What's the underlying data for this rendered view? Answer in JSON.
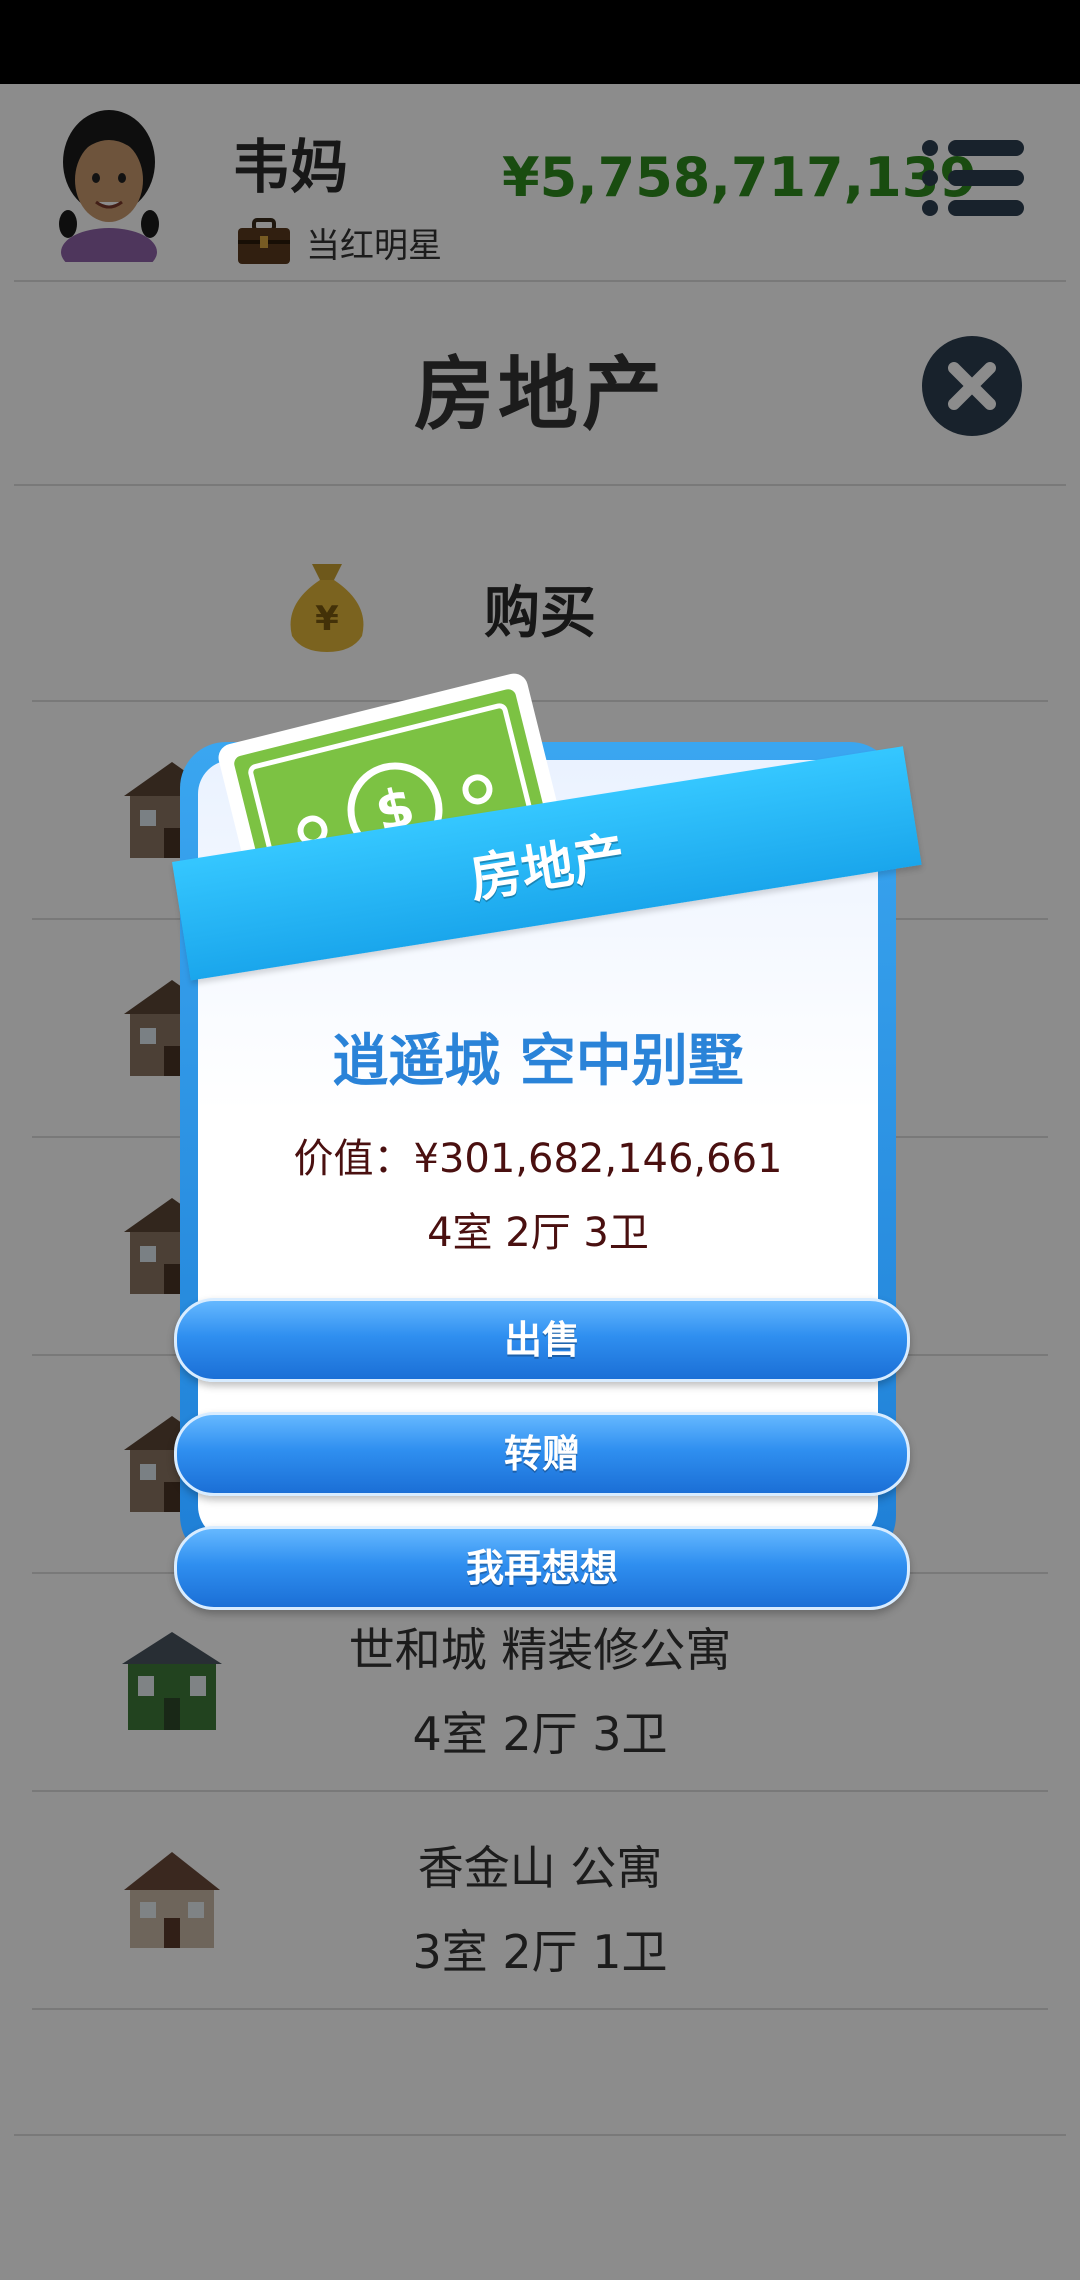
{
  "header": {
    "player_name": "韦妈",
    "job_title": "当红明星",
    "money": "¥5,758,717,139"
  },
  "page": {
    "title": "房地产",
    "buy_label": "购买"
  },
  "properties": [
    {
      "name": "",
      "rooms": ""
    },
    {
      "name": "",
      "rooms": ""
    },
    {
      "name": "",
      "rooms": ""
    },
    {
      "name": "",
      "rooms": ""
    },
    {
      "name": "世和城 精装修公寓",
      "rooms": "4室 2厅 3卫"
    },
    {
      "name": "香金山 公寓",
      "rooms": "3室 2厅 1卫"
    }
  ],
  "modal": {
    "header": "房地产",
    "property_name": "逍遥城 空中别墅",
    "value_label": "价值：¥301,682,146,661",
    "rooms": "4室 2厅 3卫",
    "sell_label": "出售",
    "gift_label": "转赠",
    "cancel_label": "我再想想"
  },
  "colors": {
    "money": "#2e8b1e",
    "modal_accent": "#1f7fd6",
    "ribbon": "#1aa6ec",
    "title_blue": "#2a83d8"
  }
}
